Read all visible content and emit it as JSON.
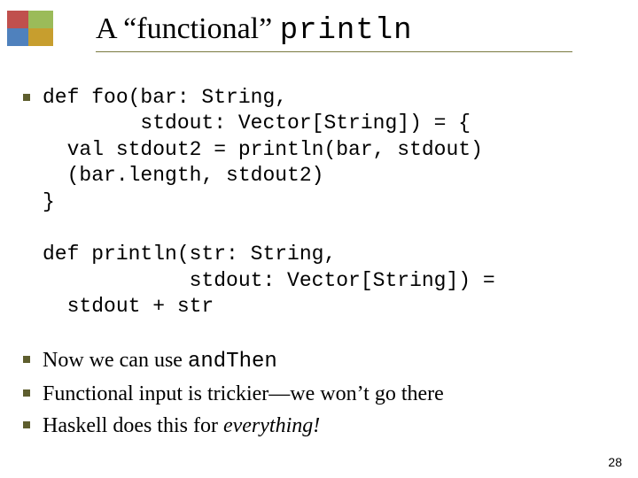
{
  "title": {
    "prefix": "A “functional” ",
    "code": "println"
  },
  "code1": {
    "l1": "def foo(bar: String,",
    "l2": "        stdout: Vector[String]) = {",
    "l3": "  val stdout2 = println(bar, stdout)",
    "l4": "  (bar.length, stdout2)",
    "l5": "}"
  },
  "code2": {
    "l1": "def println(str: String,",
    "l2": "            stdout: Vector[String]) =",
    "l3": "  stdout + str"
  },
  "point_a": {
    "pre": "Now we can use ",
    "code": "andThen"
  },
  "point_b": "Functional input is trickier—we won’t go there",
  "point_c": {
    "pre": "Haskell does this for ",
    "em": "everything!"
  },
  "page_number": "28",
  "logo_colors": {
    "red": "#c0504d",
    "green": "#9bbb59",
    "blue": "#4f81bd",
    "gold": "#c79e2e"
  }
}
